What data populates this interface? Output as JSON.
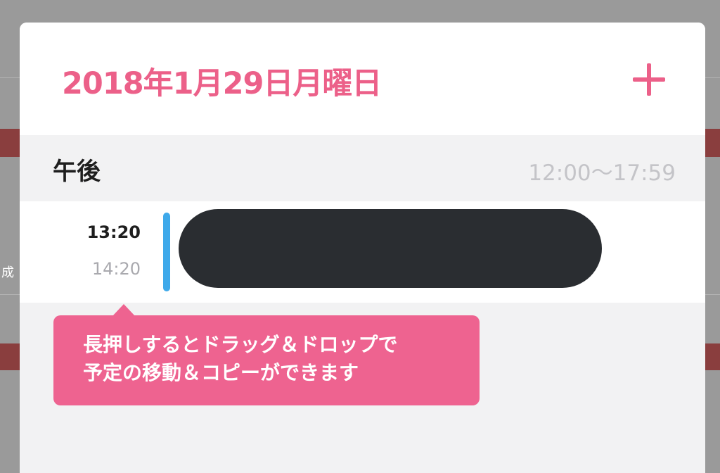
{
  "background": {
    "fragment_text": "成"
  },
  "header": {
    "date_title": "2018年1月29日月曜日",
    "add_icon": "plus-icon"
  },
  "section": {
    "label": "午後",
    "time_range": "12:00〜17:59"
  },
  "event": {
    "start_time": "13:20",
    "end_time": "14:20",
    "bar_color": "#3ea9ea"
  },
  "tooltip": {
    "line1": "長押しするとドラッグ＆ドロップで",
    "line2": "予定の移動＆コピーができます"
  },
  "colors": {
    "accent": "#ec6089",
    "tooltip_bg": "#ee6390",
    "redaction": "#2a2d31"
  }
}
